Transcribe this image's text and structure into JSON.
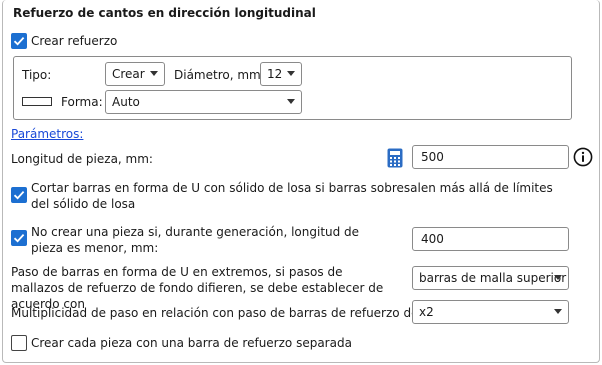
{
  "section_title": "Refuerzo de cantos en dirección longitudinal",
  "create_reinforcement": {
    "label": "Crear refuerzo",
    "checked": true
  },
  "type": {
    "label": "Tipo:",
    "value": "Crear"
  },
  "diameter": {
    "label": "Diámetro, mm:",
    "value": "12"
  },
  "shape": {
    "label": "Forma:",
    "value": "Auto"
  },
  "parameters_link": "Parámetros:",
  "piece_length": {
    "label": "Longitud de pieza, mm:",
    "value": "500"
  },
  "cut_u_bars": {
    "label": "Cortar barras en forma de U con sólido de losa si barras sobresalen más allá de límites del sólido de losa",
    "checked": true
  },
  "no_piece": {
    "label": "No crear una pieza si, durante generación, longitud de pieza es menor, mm:",
    "checked": true,
    "value": "400"
  },
  "u_bar_pitch": {
    "label": "Paso de barras en forma de U en extremos, si pasos de mallazos de refuerzo de fondo difieren, se debe establecer de acuerdo con",
    "value": "barras de malla superior"
  },
  "pitch_multiplicity": {
    "label": "Multiplicidad de paso en relación con paso de barras de refuerzo de fondo",
    "value": "x2"
  },
  "separate_bar": {
    "label": "Crear cada pieza con una barra de refuerzo separada",
    "checked": false
  },
  "colors": {
    "accent": "#1c6fd1",
    "link": "#1a49d8",
    "calculator": "#2b6cc4"
  }
}
